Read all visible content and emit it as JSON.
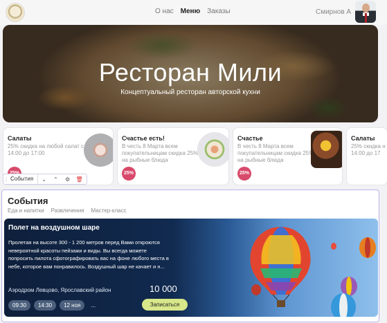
{
  "header": {
    "nav": [
      {
        "label": "О нас",
        "active": false
      },
      {
        "label": "Меню",
        "active": true
      },
      {
        "label": "Заказы",
        "active": false
      }
    ],
    "user_name": "Смирнов А"
  },
  "hero": {
    "title": "Ресторан Мили",
    "subtitle": "Концептуальный ресторан авторской кухни"
  },
  "promos": [
    {
      "title": "Салаты",
      "desc": [
        "25% скидка на любой салат с",
        "14:00 до 17:00"
      ],
      "badge": "25%"
    },
    {
      "title": "Счастье есть!",
      "desc": [
        "В честь 8 Марта всем",
        "покупательницам скидка 25%",
        "на рыбные блюда"
      ],
      "badge": "25%"
    },
    {
      "title": "Счастье",
      "desc": [
        "В честь 8 Марта всем",
        "покупательницам скидка 25%",
        "на рыбные блюда"
      ],
      "badge": "25%"
    },
    {
      "title": "Салаты",
      "desc": [
        "25% скидка н",
        "14:00 до 17"
      ],
      "badge": ""
    }
  ],
  "toolbar": {
    "label": "События",
    "icons": [
      "chevron-down-icon",
      "chevron-up-icon",
      "settings-icon",
      "trash-icon"
    ]
  },
  "events": {
    "title": "События",
    "tabs": [
      "Еда и напитки",
      "Развлечения",
      "Мастер-класс"
    ],
    "featured": {
      "name": "Полет на воздушном шаре",
      "description_lines": [
        "Пролетая на высоте 300 - 1 200 метров перед Вами откроются",
        "невероятной красоты пейзажи и виды. Вы всегда можете",
        "попросить пилота сфотографировать вас на фоне любого места в",
        "небе, которое вам понравилось. Воздушный шар не качает и н..."
      ],
      "place": "Аэродром Левцово, Ярославский район",
      "price": "10 000",
      "slots": [
        "09:30",
        "14:30",
        "12 ноя"
      ],
      "more": "...",
      "book_label": "Записаться"
    }
  },
  "colors": {
    "badge": "#d84a6b",
    "book_button": "#d7e78a",
    "event_card_dark": "#0e1f3b",
    "selection_border": "#b8b4ea"
  }
}
